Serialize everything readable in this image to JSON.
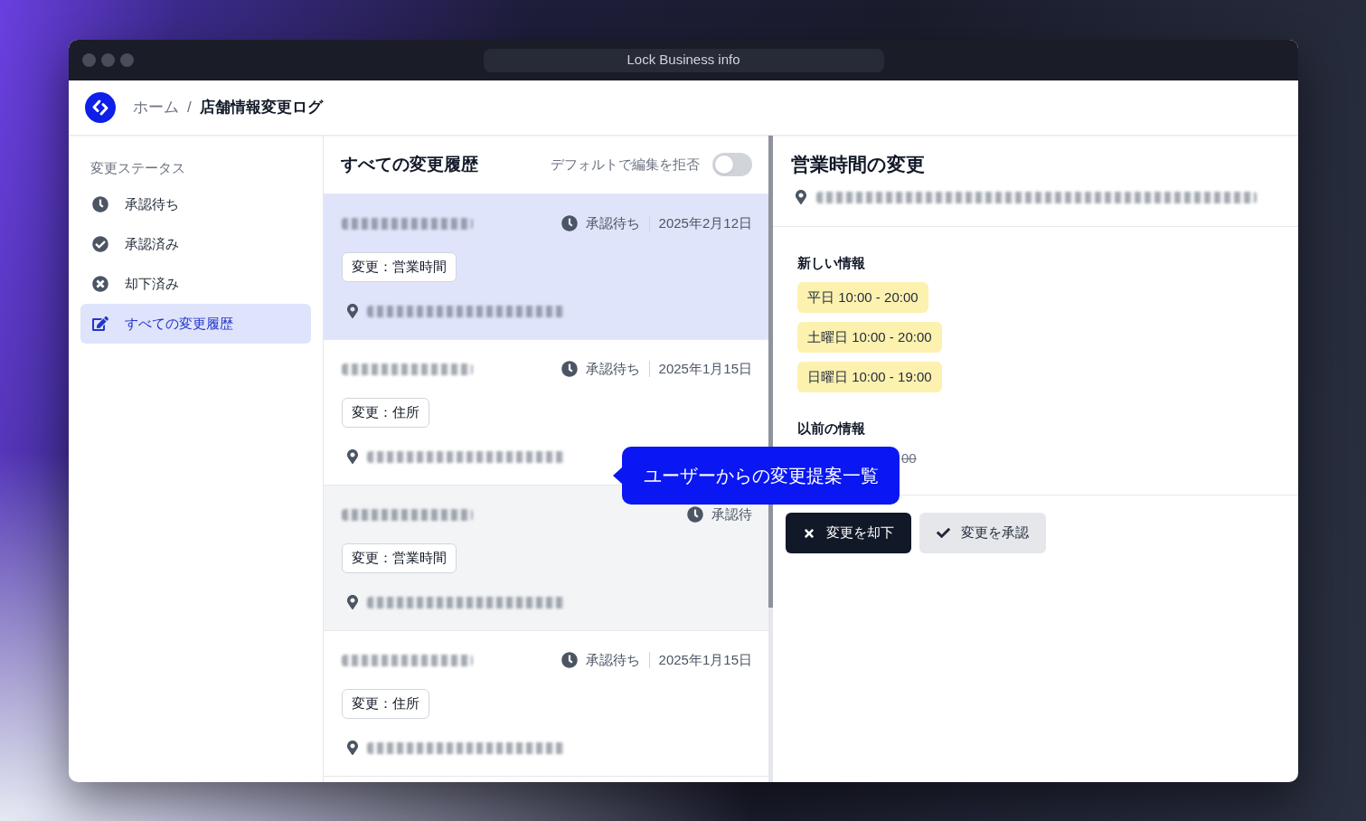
{
  "window": {
    "title": "Lock Business info"
  },
  "header": {
    "breadcrumb": [
      {
        "label": "ホーム",
        "current": false
      },
      {
        "label": "店舗情報変更ログ",
        "current": true
      }
    ],
    "separator": "/"
  },
  "sidebar": {
    "heading": "変更ステータス",
    "items": [
      {
        "kind": "pending",
        "label": "承認待ち",
        "selected": false
      },
      {
        "kind": "approved",
        "label": "承認済み",
        "selected": false
      },
      {
        "kind": "rejected",
        "label": "却下済み",
        "selected": false
      },
      {
        "kind": "all",
        "label": "すべての変更履歴",
        "selected": true
      }
    ]
  },
  "change_list": {
    "title": "すべての変更履歴",
    "toggle": {
      "label": "デフォルトで編集を拒否",
      "on": false
    },
    "items": [
      {
        "selected": true,
        "hovered": false,
        "status": {
          "kind": "pending",
          "label": "承認待ち"
        },
        "date": "2025年2月12日",
        "tag": "変更：営業時間"
      },
      {
        "selected": false,
        "hovered": false,
        "status": {
          "kind": "pending",
          "label": "承認待ち"
        },
        "date": "2025年1月15日",
        "tag": "変更：住所"
      },
      {
        "selected": false,
        "hovered": true,
        "status": {
          "kind": "pending",
          "label": "承認待"
        },
        "tag": "変更：営業時間"
      },
      {
        "selected": false,
        "hovered": false,
        "status": {
          "kind": "pending",
          "label": "承認待ち"
        },
        "date": "2025年1月15日",
        "tag": "変更：住所"
      }
    ]
  },
  "detail": {
    "title": "営業時間の変更",
    "new_info": {
      "heading": "新しい情報",
      "values": [
        "平日 10:00 - 20:00",
        "土曜日 10:00 - 20:00",
        "日曜日 10:00 - 19:00"
      ]
    },
    "previous_info": {
      "heading": "以前の情報",
      "values": [
        "00"
      ]
    },
    "actions": [
      {
        "kind": "reject",
        "label": "変更を却下"
      },
      {
        "kind": "approve",
        "label": "変更を承認"
      }
    ]
  },
  "tooltip": {
    "text": "ユーザーからの変更提案一覧"
  }
}
